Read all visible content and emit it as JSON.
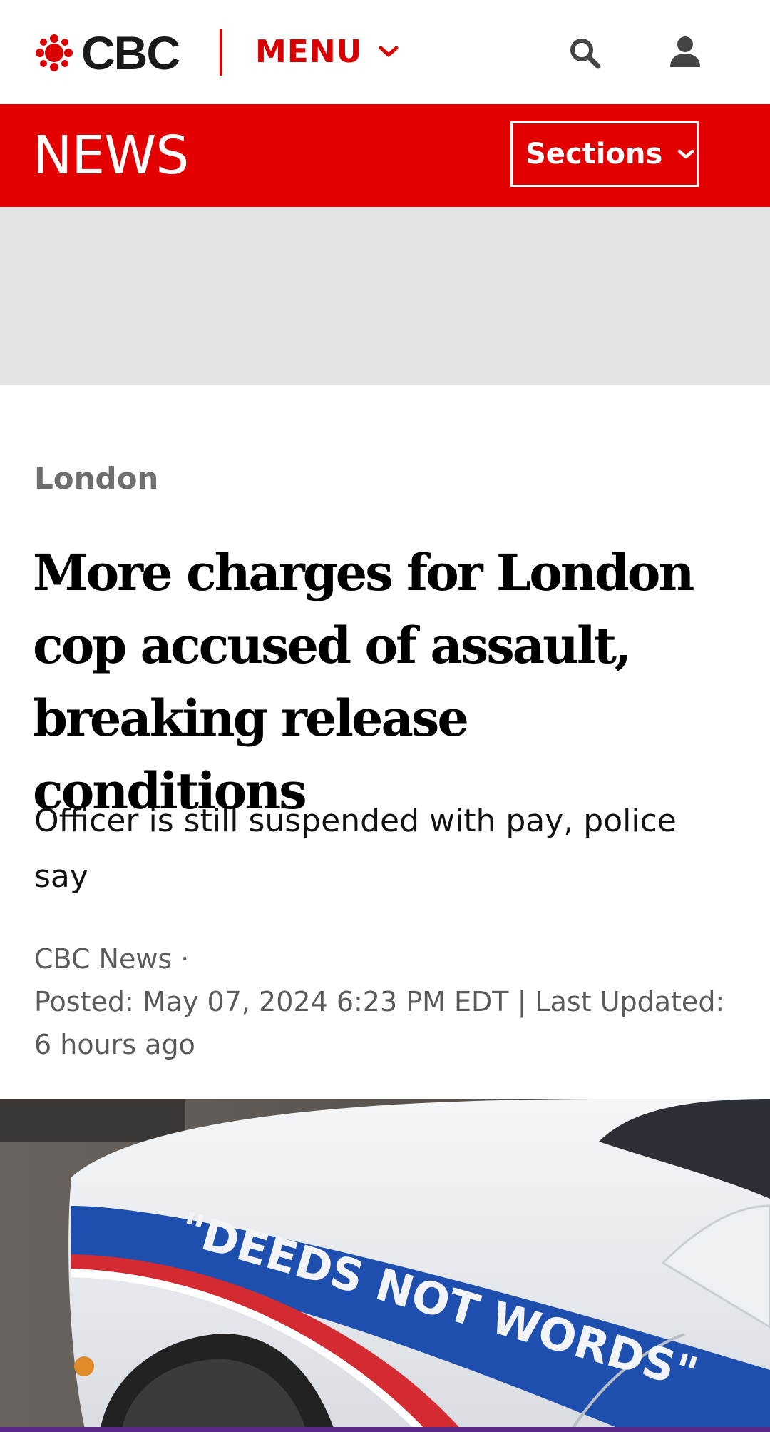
{
  "header": {
    "brand": "CBC",
    "menu_label": "MENU",
    "icons": {
      "menu": "chevron-down-icon",
      "search": "search-icon",
      "account": "user-icon"
    },
    "brand_color": "#d80000"
  },
  "newsbar": {
    "title": "NEWS",
    "sections_label": "Sections",
    "background": "#e20000"
  },
  "article": {
    "category": "London",
    "headline": "More charges for London cop accused of assault, breaking release conditions",
    "dek": "Officer is still suspended with pay, police say",
    "byline": {
      "source": "CBC News ·",
      "posted": "Posted: May 07, 2024 6:23 PM EDT | Last Updated: 6 hours ago"
    },
    "hero_image": {
      "car_lettering": "\"DEEDS NOT WORDS\""
    }
  }
}
